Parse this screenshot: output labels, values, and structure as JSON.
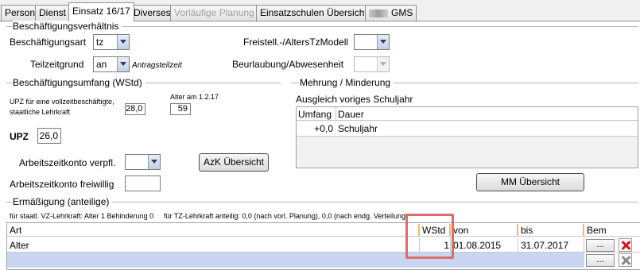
{
  "tabs": [
    {
      "label": "Person",
      "active": false,
      "disabled": false
    },
    {
      "label": "Dienst",
      "active": false,
      "disabled": false
    },
    {
      "label": "Einsatz 16/17",
      "active": true,
      "disabled": false
    },
    {
      "label": "Diverses",
      "active": false,
      "disabled": false
    },
    {
      "label": "Vorläufige Planung",
      "active": false,
      "disabled": true
    },
    {
      "label": "Einsatzschulen Übersicht",
      "active": false,
      "disabled": false
    },
    {
      "label": "GMS",
      "active": false,
      "disabled": false
    }
  ],
  "beschaeftigung": {
    "group_title": "Beschäftigungsverhältnis",
    "art_label": "Beschäftigungsart",
    "art_value": "tz",
    "teilzeitgrund_label": "Teilzeitgrund",
    "teilzeitgrund_value": "an",
    "antragsteilzeit": "Antragsteilzeit",
    "freistell_label": "Freistell.-/AltersTzModell",
    "freistell_value": "",
    "beurlaubung_label": "Beurlaubung/Abwesenheit",
    "beurlaubung_value": ""
  },
  "umfang": {
    "group_title": "Beschäftigungsumfang (WStd)",
    "upz_vollzeit_label_1": "UPZ für eine vollzeitbeschäftigte,",
    "upz_vollzeit_label_2": "staatliche Lehrkraft",
    "upz_vollzeit_value": "28,0",
    "alter_label": "Alter am 1.2.17",
    "alter_value": "59",
    "upz_label": "UPZ",
    "upz_value": "26,0",
    "konto_verpfl_label": "Arbeitszeitkonto verpfl.",
    "konto_verpfl_value": "",
    "azk_button": "AzK Übersicht",
    "konto_freiwillig_label": "Arbeitszeitkonto freiwillig",
    "konto_freiwillig_value": ""
  },
  "mehrung": {
    "group_title": "Mehrung / Minderung",
    "ausgleich_label": "Ausgleich voriges Schuljahr",
    "col_umfang": "Umfang",
    "col_dauer": "Dauer",
    "row_umfang": "+0,0",
    "row_dauer": "Schuljahr",
    "mm_button": "MM Übersicht"
  },
  "ermaessigung": {
    "group_title": "Ermäßigung (anteilige)",
    "info_vz": "für staatl. VZ-Lehrkraft: Alter 1 Behinderung 0",
    "info_tz": "für TZ-Lehrkraft anteilig: 0,0 (nach vorl. Planung), 0,0 (nach endg. Verteilung)",
    "columns": {
      "art": "Art",
      "wstd": "WStd",
      "von": "von",
      "bis": "bis",
      "bem": "Bem"
    },
    "rows": [
      {
        "art": "Alter",
        "wstd": "1",
        "von": "01.08.2015",
        "bis": "31.07.2017",
        "bem": "..."
      }
    ],
    "new_row_bem": "..."
  }
}
